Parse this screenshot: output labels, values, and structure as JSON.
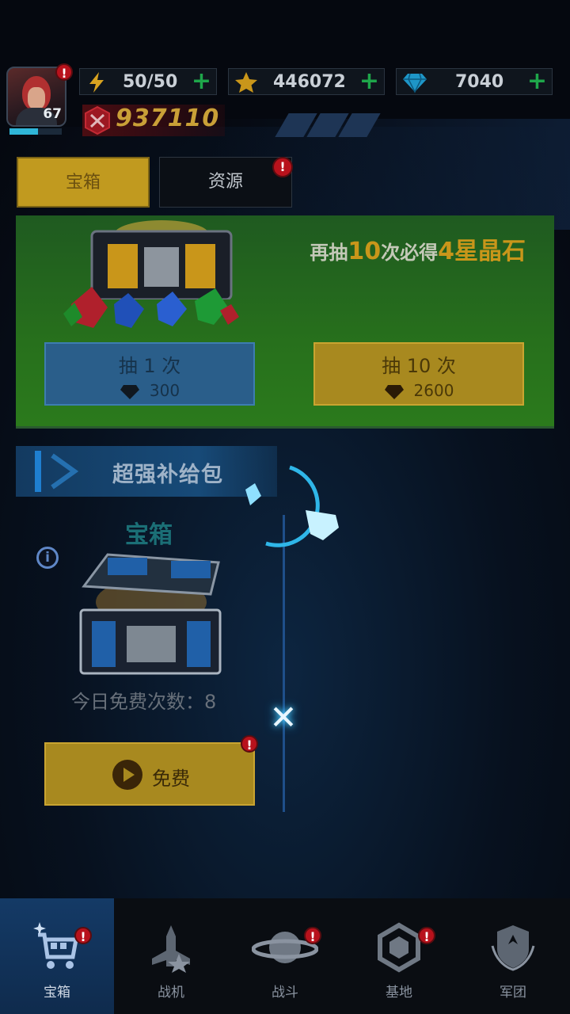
{
  "player": {
    "level": "67",
    "xp_fraction": 0.55
  },
  "resources": {
    "energy": "50/50",
    "gold": "446072",
    "diamonds": "7040"
  },
  "combat_power": "937110",
  "tabs": [
    {
      "label": "宝箱",
      "active": true
    },
    {
      "label": "资源",
      "active": false
    }
  ],
  "banner": {
    "prefix": "再抽",
    "count": "10",
    "middle": "次必得",
    "reward": "4星晶石"
  },
  "draw_buttons": [
    {
      "label": "抽 1 次",
      "cost": "300"
    },
    {
      "label": "抽 10 次",
      "cost": "2600"
    }
  ],
  "supply": {
    "section_title": "超强补给包",
    "chest_title": "宝箱",
    "free_count": "今日免费次数：8",
    "free_button": "免费"
  },
  "alert_mark": "!",
  "info_mark": "i",
  "close_mark": "✕",
  "nav": [
    {
      "label": "宝箱",
      "icon": "cart-icon",
      "active": true,
      "alert": true
    },
    {
      "label": "战机",
      "icon": "fighter-icon",
      "active": false,
      "alert": false
    },
    {
      "label": "战斗",
      "icon": "planet-icon",
      "active": false,
      "alert": true
    },
    {
      "label": "基地",
      "icon": "base-icon",
      "active": false,
      "alert": true
    },
    {
      "label": "军团",
      "icon": "legion-icon",
      "active": false,
      "alert": false
    }
  ],
  "colors": {
    "gold_button": "#a8891f",
    "blue_button": "#2a5e8a",
    "banner_green": "#27701c",
    "alert_red": "#b8121c"
  }
}
